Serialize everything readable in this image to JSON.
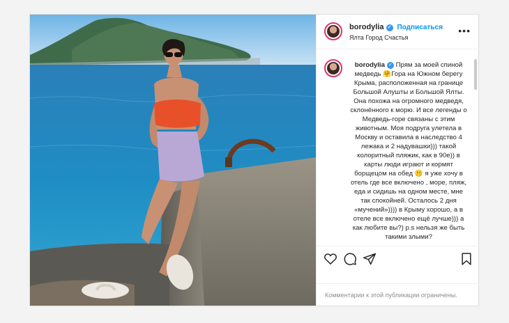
{
  "post": {
    "username": "borodylia",
    "follow_label": "Подписаться",
    "location": "Ялта Город Счастья",
    "more_icon": "more-dots-icon",
    "verified_icon": "verified-badge-icon",
    "caption_username": "borodylia",
    "caption_text": "Прям за моей спиной медведь 🤗Гора на Южном берегу Крыма, расположенная на границе Большой Алушты и Большой Ялты. Она похожа на огромного медведя, склонённого к морю. И все легенды о Медведь-горе связаны с этим животным. Моя подруга улетела в Москву и оставила в наследство 4 лежака и 2 надувашки))) такой колоритный пляжик, как в 90е)) в карты люди играют и кормят борщецом на обед 🤫 я уже хочу в отель где все включено , море, пляж, еда и сидишь на одном месте, мне так спокойней. Осталось 2 дня «мучений»)))) в Крыму хорошо, а в отеле все включено ещё лучше))) а как любите вы?) p.s нельзя же быть такими злыми?",
    "comments_disabled": "Комментарии к этой публикации ограничены."
  },
  "actions": {
    "like_icon": "heart-icon",
    "comment_icon": "comment-icon",
    "share_icon": "share-icon",
    "save_icon": "bookmark-icon"
  },
  "colors": {
    "accent": "#0095f6",
    "verified": "#3897f0",
    "border": "#dbdbdb",
    "muted": "#8e8e8e"
  }
}
